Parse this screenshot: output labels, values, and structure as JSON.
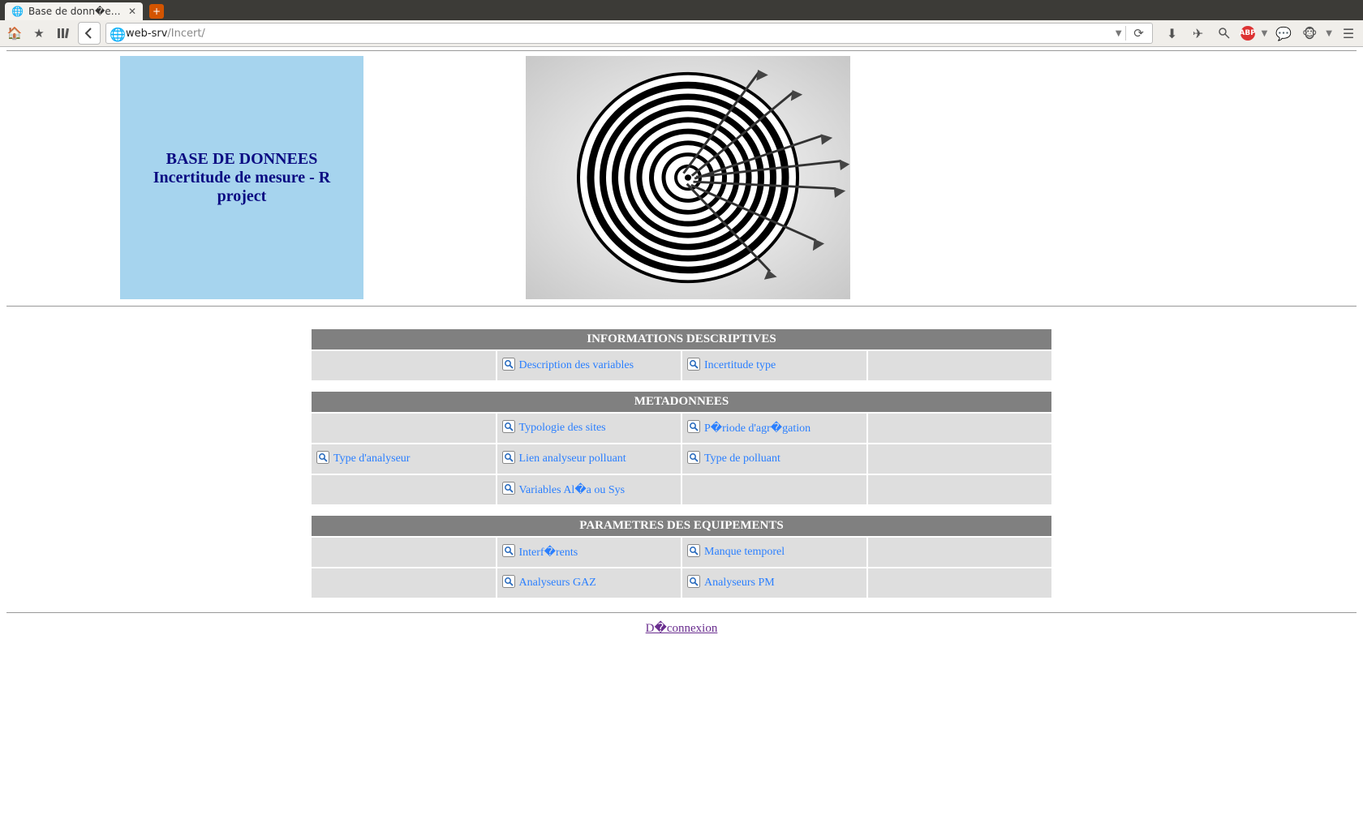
{
  "browser": {
    "tab_title": "Base de donn�es INCE...",
    "url_host": "web-srv",
    "url_path": "/Incert/"
  },
  "header": {
    "title_line1": "BASE DE DONNEES",
    "title_line2": "Incertitude de mesure - R",
    "title_line3": "project"
  },
  "sections": [
    {
      "title": "INFORMATIONS DESCRIPTIVES",
      "rows": [
        [
          {
            "label": "",
            "link": false
          },
          {
            "label": "Description des variables",
            "link": true
          },
          {
            "label": "Incertitude type",
            "link": true
          },
          {
            "label": "",
            "link": false
          }
        ]
      ]
    },
    {
      "title": "METADONNEES",
      "rows": [
        [
          {
            "label": "",
            "link": false
          },
          {
            "label": "Typologie des sites",
            "link": true
          },
          {
            "label": "P�riode d'agr�gation",
            "link": true
          },
          {
            "label": "",
            "link": false
          }
        ],
        [
          {
            "label": "Type d'analyseur",
            "link": true
          },
          {
            "label": "Lien analyseur polluant",
            "link": true
          },
          {
            "label": "Type de polluant",
            "link": true
          },
          {
            "label": "",
            "link": false
          }
        ],
        [
          {
            "label": "",
            "link": false
          },
          {
            "label": "Variables Al�a ou Sys",
            "link": true
          },
          {
            "label": "",
            "link": false
          },
          {
            "label": "",
            "link": false
          }
        ]
      ]
    },
    {
      "title": "PARAMETRES DES EQUIPEMENTS",
      "rows": [
        [
          {
            "label": "",
            "link": false
          },
          {
            "label": "Interf�rents",
            "link": true
          },
          {
            "label": "Manque temporel",
            "link": true
          },
          {
            "label": "",
            "link": false
          }
        ],
        [
          {
            "label": "",
            "link": false
          },
          {
            "label": "Analyseurs GAZ",
            "link": true
          },
          {
            "label": "Analyseurs PM",
            "link": true
          },
          {
            "label": "",
            "link": false
          }
        ]
      ]
    }
  ],
  "logout_label": "D�connexion"
}
